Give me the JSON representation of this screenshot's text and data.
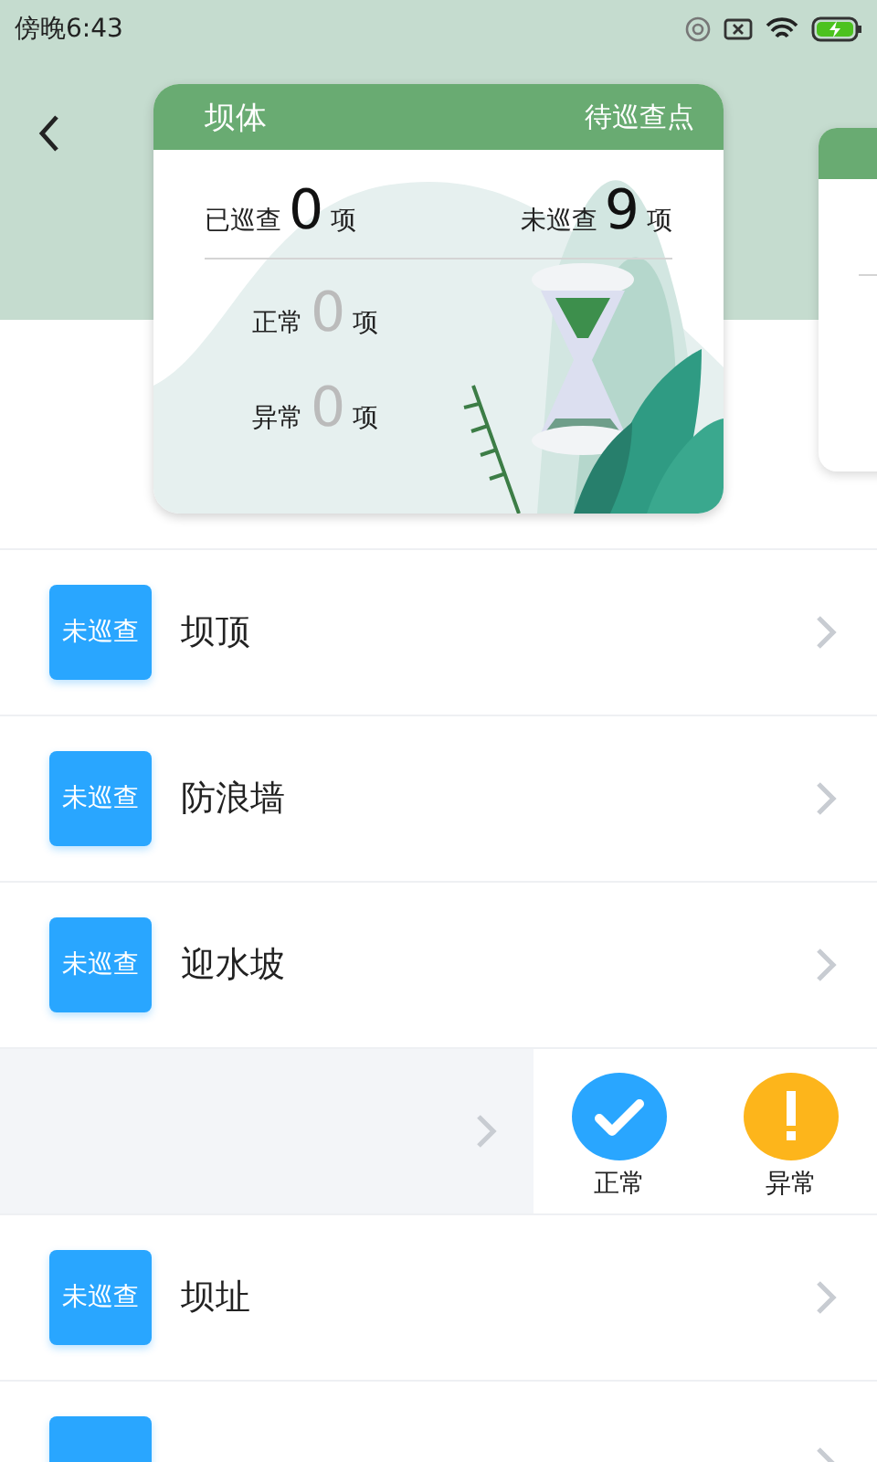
{
  "status_bar": {
    "time": "傍晚6:43"
  },
  "card": {
    "title": "坝体",
    "subtitle": "待巡查点",
    "stats": [
      {
        "label": "已巡查",
        "count": "0",
        "unit": "项"
      },
      {
        "label": "未巡查",
        "count": "9",
        "unit": "项"
      }
    ],
    "results": [
      {
        "label": "正常",
        "count": "0",
        "unit": "项"
      },
      {
        "label": "异常",
        "count": "0",
        "unit": "项"
      }
    ]
  },
  "rows": [
    {
      "kind": "item",
      "status": "未巡查",
      "name": "坝顶"
    },
    {
      "kind": "item",
      "status": "未巡查",
      "name": "防浪墙"
    },
    {
      "kind": "item",
      "status": "未巡查",
      "name": "迎水坡"
    },
    {
      "kind": "swiped",
      "actions": [
        {
          "kind": "normal",
          "label": "正常"
        },
        {
          "kind": "abnormal",
          "label": "异常"
        }
      ]
    },
    {
      "kind": "item",
      "status": "未巡查",
      "name": "坝址"
    },
    {
      "kind": "item"
    }
  ]
}
